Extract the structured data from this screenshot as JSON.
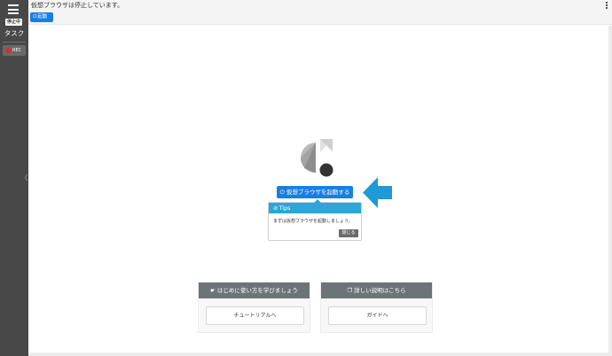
{
  "sidebar": {
    "menu_icon": "hamburger-icon",
    "status_badge": "停止中",
    "task_label": "タスク",
    "rec_label": "REC",
    "rec_color": "#e8232b"
  },
  "topbar": {
    "status_text": "仮想ブラウザは停止しています。",
    "start_label": "起動",
    "more_icon": "kebab-menu-icon"
  },
  "main": {
    "start_button_label": "仮想ブラウザを起動する",
    "tips": {
      "title": "Tips",
      "body": "まずは仮想ブラウザを起動しましょう。",
      "close_label": "閉じる"
    },
    "cards": [
      {
        "title": "はじめに使い方を学びましょう",
        "button_label": "チュートリアルへ",
        "icon": "hand-icon"
      },
      {
        "title": "詳しい説明はこちら",
        "button_label": "ガイドへ",
        "icon": "book-icon"
      }
    ]
  },
  "colors": {
    "primary": "#1a7ee0",
    "tips_header": "#2aa6d8",
    "card_header": "#6c7478",
    "sidebar": "#484848"
  }
}
